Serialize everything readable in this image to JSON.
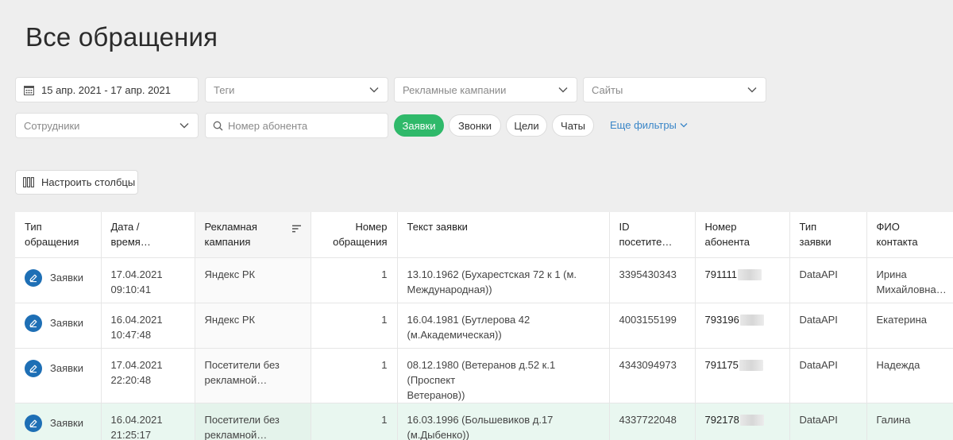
{
  "page": {
    "title": "Все обращения"
  },
  "filters": {
    "date_range": "15 апр. 2021 - 17 апр. 2021",
    "tags_placeholder": "Теги",
    "campaigns_placeholder": "Рекламные кампании",
    "sites_placeholder": "Сайты",
    "employees_placeholder": "Сотрудники",
    "phone_placeholder": "Номер абонента",
    "types": [
      {
        "label": "Заявки",
        "active": true
      },
      {
        "label": "Звонки",
        "active": false
      },
      {
        "label": "Цели",
        "active": false
      },
      {
        "label": "Чаты",
        "active": false
      }
    ],
    "more_filters": "Еще фильтры"
  },
  "toolbar": {
    "configure_columns": "Настроить столбцы"
  },
  "table": {
    "columns": [
      {
        "l1": "Тип",
        "l2": "обращения"
      },
      {
        "l1": "Дата /",
        "l2": "время…"
      },
      {
        "l1": "Рекламная",
        "l2": "кампания"
      },
      {
        "l1": "Номер",
        "l2": "обращения"
      },
      {
        "l1": "Текст заявки",
        "l2": ""
      },
      {
        "l1": "ID",
        "l2": "посетите…"
      },
      {
        "l1": "Номер",
        "l2": "абонента"
      },
      {
        "l1": "Тип",
        "l2": "заявки"
      },
      {
        "l1": "ФИО",
        "l2": "контакта"
      }
    ],
    "rows": [
      {
        "type": "Заявки",
        "date": "17.04.2021",
        "time": "09:10:41",
        "campaign_1": "Яндекс РК",
        "campaign_2": "",
        "number": "1",
        "text_1": "13.10.1962 (Бухарестская 72 к 1 (м.",
        "text_2": "Международная))",
        "visitor_id": "3395430343",
        "phone": "791111",
        "request_type": "DataAPI",
        "name_1": "Ирина",
        "name_2": "Михайловна…"
      },
      {
        "type": "Заявки",
        "date": "16.04.2021",
        "time": "10:47:48",
        "campaign_1": "Яндекс РК",
        "campaign_2": "",
        "number": "1",
        "text_1": "16.04.1981 (Бутлерова 42",
        "text_2": "(м.Академическая))",
        "visitor_id": "4003155199",
        "phone": "793196",
        "request_type": "DataAPI",
        "name_1": "Екатерина",
        "name_2": ""
      },
      {
        "type": "Заявки",
        "date": "17.04.2021",
        "time": "22:20:48",
        "campaign_1": "Посетители без",
        "campaign_2": "рекламной…",
        "number": "1",
        "text_1": "08.12.1980 (Ветеранов д.52 к.1 (Проспект",
        "text_2": "Ветеранов))",
        "visitor_id": "4343094973",
        "phone": "791175",
        "request_type": "DataAPI",
        "name_1": "Надежда",
        "name_2": ""
      },
      {
        "type": "Заявки",
        "date": "16.04.2021",
        "time": "21:25:17",
        "campaign_1": "Посетители без",
        "campaign_2": "рекламной…",
        "number": "1",
        "text_1": "16.03.1996 (Большевиков д.17",
        "text_2": "(м.Дыбенко))",
        "visitor_id": "4337722048",
        "phone": "792178",
        "request_type": "DataAPI",
        "name_1": "Галина",
        "name_2": ""
      }
    ]
  }
}
